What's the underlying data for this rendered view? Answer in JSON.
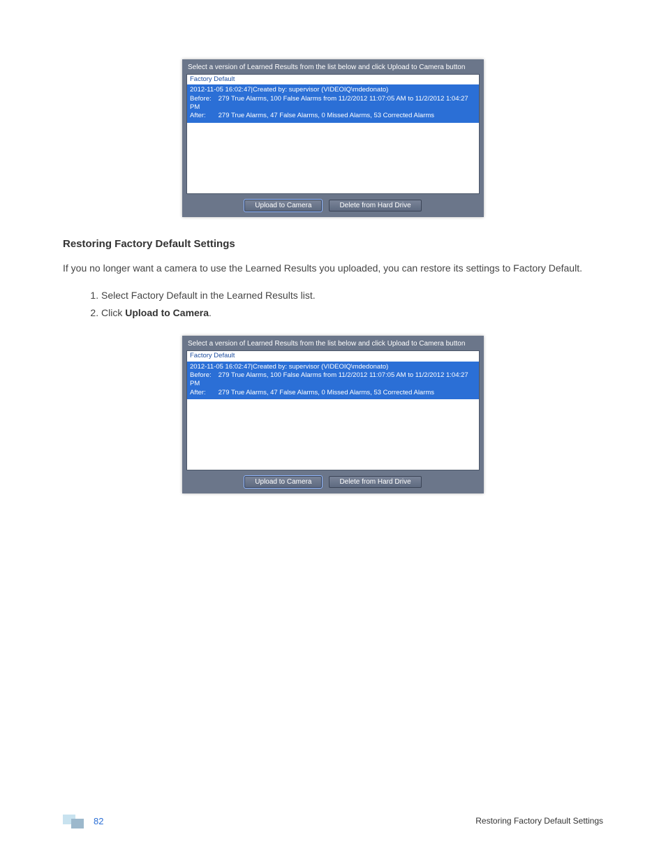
{
  "dialog": {
    "instruction": "Select a version of Learned Results from the list below and click Upload to Camera button",
    "factory_default": "Factory Default",
    "entry": {
      "header": "2012-11-05 16:02:47|Created by: supervisor (VIDEOIQ\\mdedonato)",
      "before_label": "Before:",
      "before_text": "279 True Alarms, 100 False Alarms from 11/2/2012 11:07:05 AM to 11/2/2012 1:04:27 PM",
      "after_label": "After:",
      "after_text": "279 True Alarms, 47 False Alarms, 0 Missed Alarms, 53 Corrected Alarms"
    },
    "upload_btn": "Upload to Camera",
    "delete_btn": "Delete from Hard Drive"
  },
  "section": {
    "heading": "Restoring Factory Default Settings",
    "paragraph": "If you no longer want a camera to use the Learned Results you uploaded, you can restore its settings to Factory Default.",
    "step1": "Select Factory Default in the Learned Results list.",
    "step2_prefix": "Click ",
    "step2_bold": "Upload to Camera",
    "step2_suffix": "."
  },
  "footer": {
    "page": "82",
    "title": "Restoring Factory Default Settings"
  }
}
